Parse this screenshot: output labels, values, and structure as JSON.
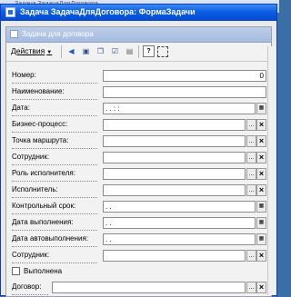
{
  "background_window": {
    "title": "Задача ЗадачаДляДоговора"
  },
  "window": {
    "title": "Задача ЗадачаДляДоговора: ФормаЗадачи"
  },
  "form": {
    "title": "Задача для договора"
  },
  "toolbar": {
    "actions_label": "Действия",
    "buttons": [
      "arrow-left-icon",
      "find-icon",
      "copy-icon",
      "check-icon",
      "doc-icon",
      "help-icon",
      "frame-icon"
    ]
  },
  "fields": {
    "number": {
      "label": "Номер:",
      "value": "0"
    },
    "name": {
      "label": "Наименование:",
      "value": ""
    },
    "date": {
      "label": "Дата:",
      "value": " .  .     :  :"
    },
    "business_process": {
      "label": "Бизнес-процесс:",
      "value": ""
    },
    "route_point": {
      "label": "Точка маршрута:",
      "value": ""
    },
    "employee": {
      "label": "Сотрудник:",
      "value": ""
    },
    "performer_role": {
      "label": "Роль исполнителя:",
      "value": ""
    },
    "performer": {
      "label": "Исполнитель:",
      "value": ""
    },
    "deadline": {
      "label": "Контрольный срок:",
      "value": " .  ."
    },
    "done_date": {
      "label": "Дата выполнения:",
      "value": " .  ."
    },
    "auto_date": {
      "label": "Дата автовыполнения:",
      "value": " .  ."
    },
    "employee2": {
      "label": "Сотрудник:",
      "value": ""
    },
    "done": {
      "label": "Выполнена",
      "checked": false
    },
    "contract": {
      "label": "Договор:",
      "value": ""
    }
  },
  "buttons": {
    "ellipsis": "...",
    "clear": "×",
    "calendar": "▦"
  },
  "colors": {
    "titlebar": "#0a5ee4",
    "inner_title": "#a6bce0",
    "form_bg": "#f2f2f2"
  }
}
